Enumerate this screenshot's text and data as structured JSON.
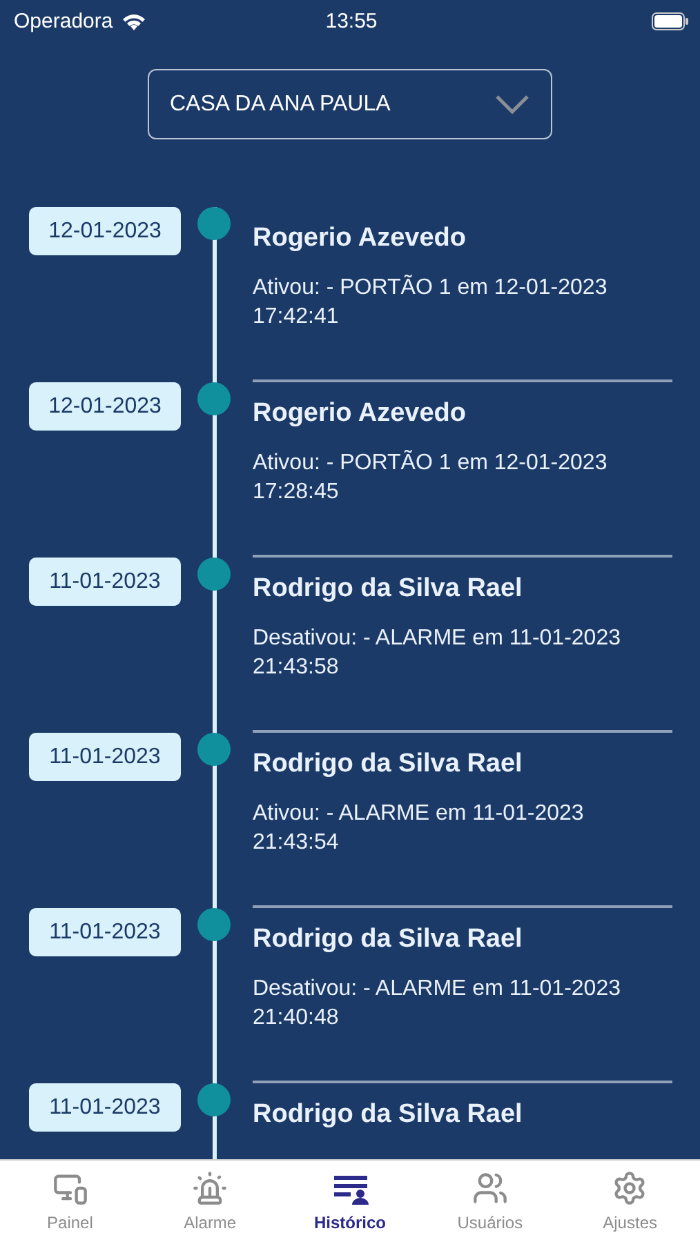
{
  "status_bar": {
    "carrier": "Operadora",
    "time": "13:55"
  },
  "selector": {
    "value": "CASA DA ANA PAULA"
  },
  "entries": [
    {
      "date": "12-01-2023",
      "name": "Rogerio Azevedo",
      "description": "Ativou: - PORTÃO 1 em 12-01-2023 17:42:41"
    },
    {
      "date": "12-01-2023",
      "name": "Rogerio Azevedo",
      "description": "Ativou: - PORTÃO 1 em 12-01-2023 17:28:45"
    },
    {
      "date": "11-01-2023",
      "name": "Rodrigo da Silva Rael",
      "description": "Desativou: - ALARME em 11-01-2023 21:43:58"
    },
    {
      "date": "11-01-2023",
      "name": "Rodrigo da Silva Rael",
      "description": "Ativou: - ALARME em 11-01-2023 21:43:54"
    },
    {
      "date": "11-01-2023",
      "name": "Rodrigo da Silva Rael",
      "description": "Desativou: - ALARME em 11-01-2023 21:40:48"
    },
    {
      "date": "11-01-2023",
      "name": "Rodrigo da Silva Rael"
    }
  ],
  "tabs": [
    {
      "kind": "devices",
      "label": "Painel",
      "selected": false
    },
    {
      "kind": "siren",
      "label": "Alarme",
      "selected": false
    },
    {
      "kind": "history",
      "label": "Histórico",
      "selected": true
    },
    {
      "kind": "users",
      "label": "Usuários",
      "selected": false
    },
    {
      "kind": "settings",
      "label": "Ajustes",
      "selected": false
    }
  ]
}
